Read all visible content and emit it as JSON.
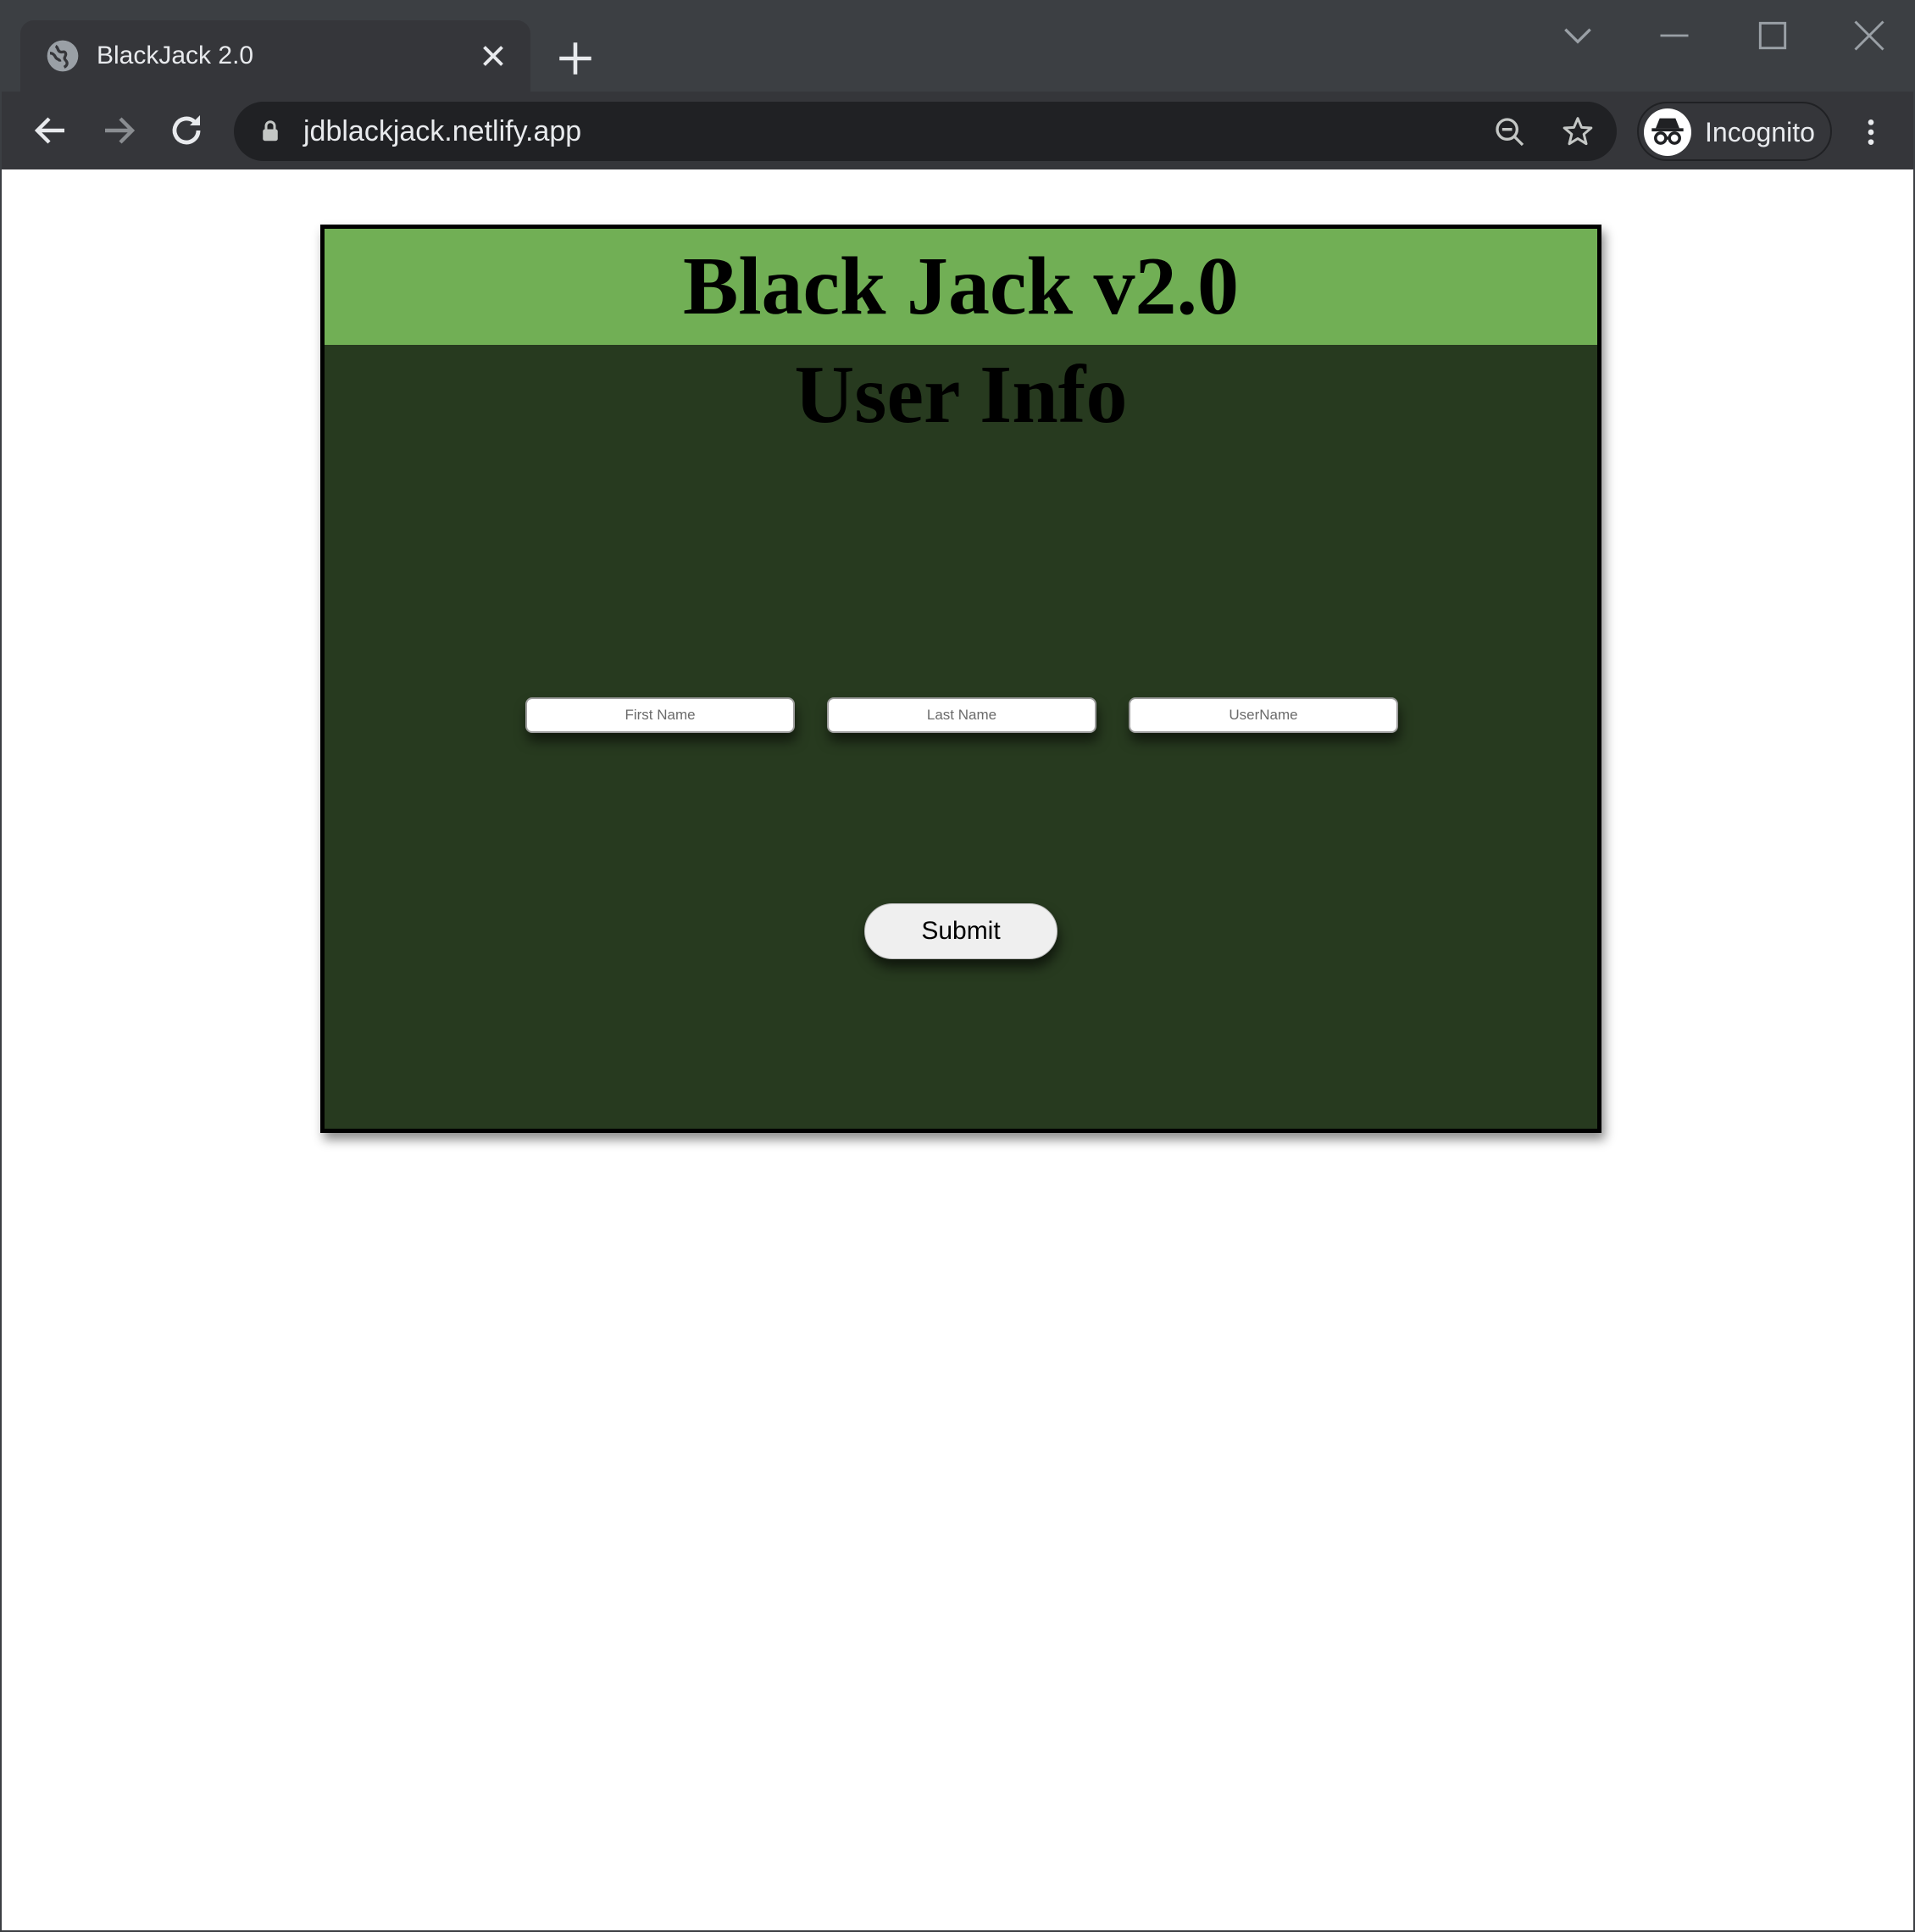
{
  "browser": {
    "tab_title": "BlackJack 2.0",
    "url": "jdblackjack.netlify.app",
    "profile_label": "Incognito"
  },
  "app": {
    "header_title": "Black Jack v2.0",
    "section_title": "User Info",
    "fields": {
      "first_name_placeholder": "First Name",
      "last_name_placeholder": "Last Name",
      "username_placeholder": "UserName"
    },
    "submit_label": "Submit"
  },
  "colors": {
    "header_bg": "#71af55",
    "panel_bg": "#273a1f",
    "browser_frame": "#3c3f43",
    "toolbar": "#35363a",
    "omnibox": "#202124"
  },
  "icons": [
    "globe-icon",
    "close-icon",
    "plus-icon",
    "chevron-down-icon",
    "minimize-icon",
    "maximize-icon",
    "window-close-icon",
    "back-icon",
    "forward-icon",
    "reload-icon",
    "lock-icon",
    "zoom-out-icon",
    "star-icon",
    "incognito-icon",
    "kebab-menu-icon"
  ]
}
